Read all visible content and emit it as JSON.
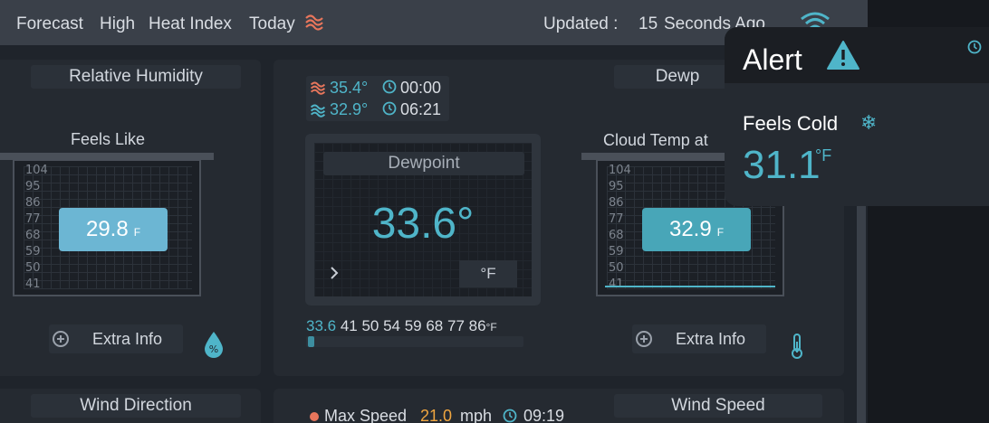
{
  "topbar": {
    "forecast": "Forecast",
    "level": "High",
    "heat_index": "Heat Index",
    "today": "Today",
    "updated_prefix": "Updated :",
    "updated_seconds": "15",
    "updated_suffix": "Seconds Ago"
  },
  "humidity_panel": {
    "title": "Relative Humidity",
    "subtitle": "Feels Like",
    "scale": [
      "104",
      "95",
      "86",
      "77",
      "68",
      "59",
      "50",
      "41"
    ],
    "value": "29.8",
    "unit": "F",
    "extra_info": "Extra Info"
  },
  "center_panel": {
    "high_temp": "35.4°",
    "high_time": "00:00",
    "low_temp": "32.9°",
    "low_time": "06:21",
    "dewpoint_label": "Dewpoint",
    "dewpoint_value": "33.6°",
    "dewpoint_unit": "°F",
    "scale_current": "33.6",
    "scale_values": "41 50 54 59 68 77 86",
    "scale_unit": "°F",
    "range_fill_fraction": 0.03
  },
  "dewpoint_panel": {
    "title": "Dewp",
    "subtitle": "Cloud Temp at",
    "scale": [
      "104",
      "95",
      "86",
      "77",
      "68",
      "59",
      "50",
      "41"
    ],
    "value": "32.9",
    "unit": "F",
    "extra_info": "Extra Info"
  },
  "wind_direction": {
    "title": "Wind Direction"
  },
  "wind_panel": {
    "max_speed_label": "Max Speed",
    "max_speed_value": "21.0",
    "max_speed_unit": "mph",
    "max_speed_time": "09:19"
  },
  "wind_speed": {
    "title": "Wind Speed"
  },
  "alert": {
    "title": "Alert",
    "message": "Feels Cold",
    "value": "31.1",
    "unit": "°F"
  },
  "colors": {
    "accent_cyan": "#4fb5c9",
    "hot_red": "#e8765c",
    "lime": "#a8c94a",
    "orange": "#f0a640",
    "value_box_light": "#6cb6d3",
    "value_box_dark": "#48a6b8"
  }
}
